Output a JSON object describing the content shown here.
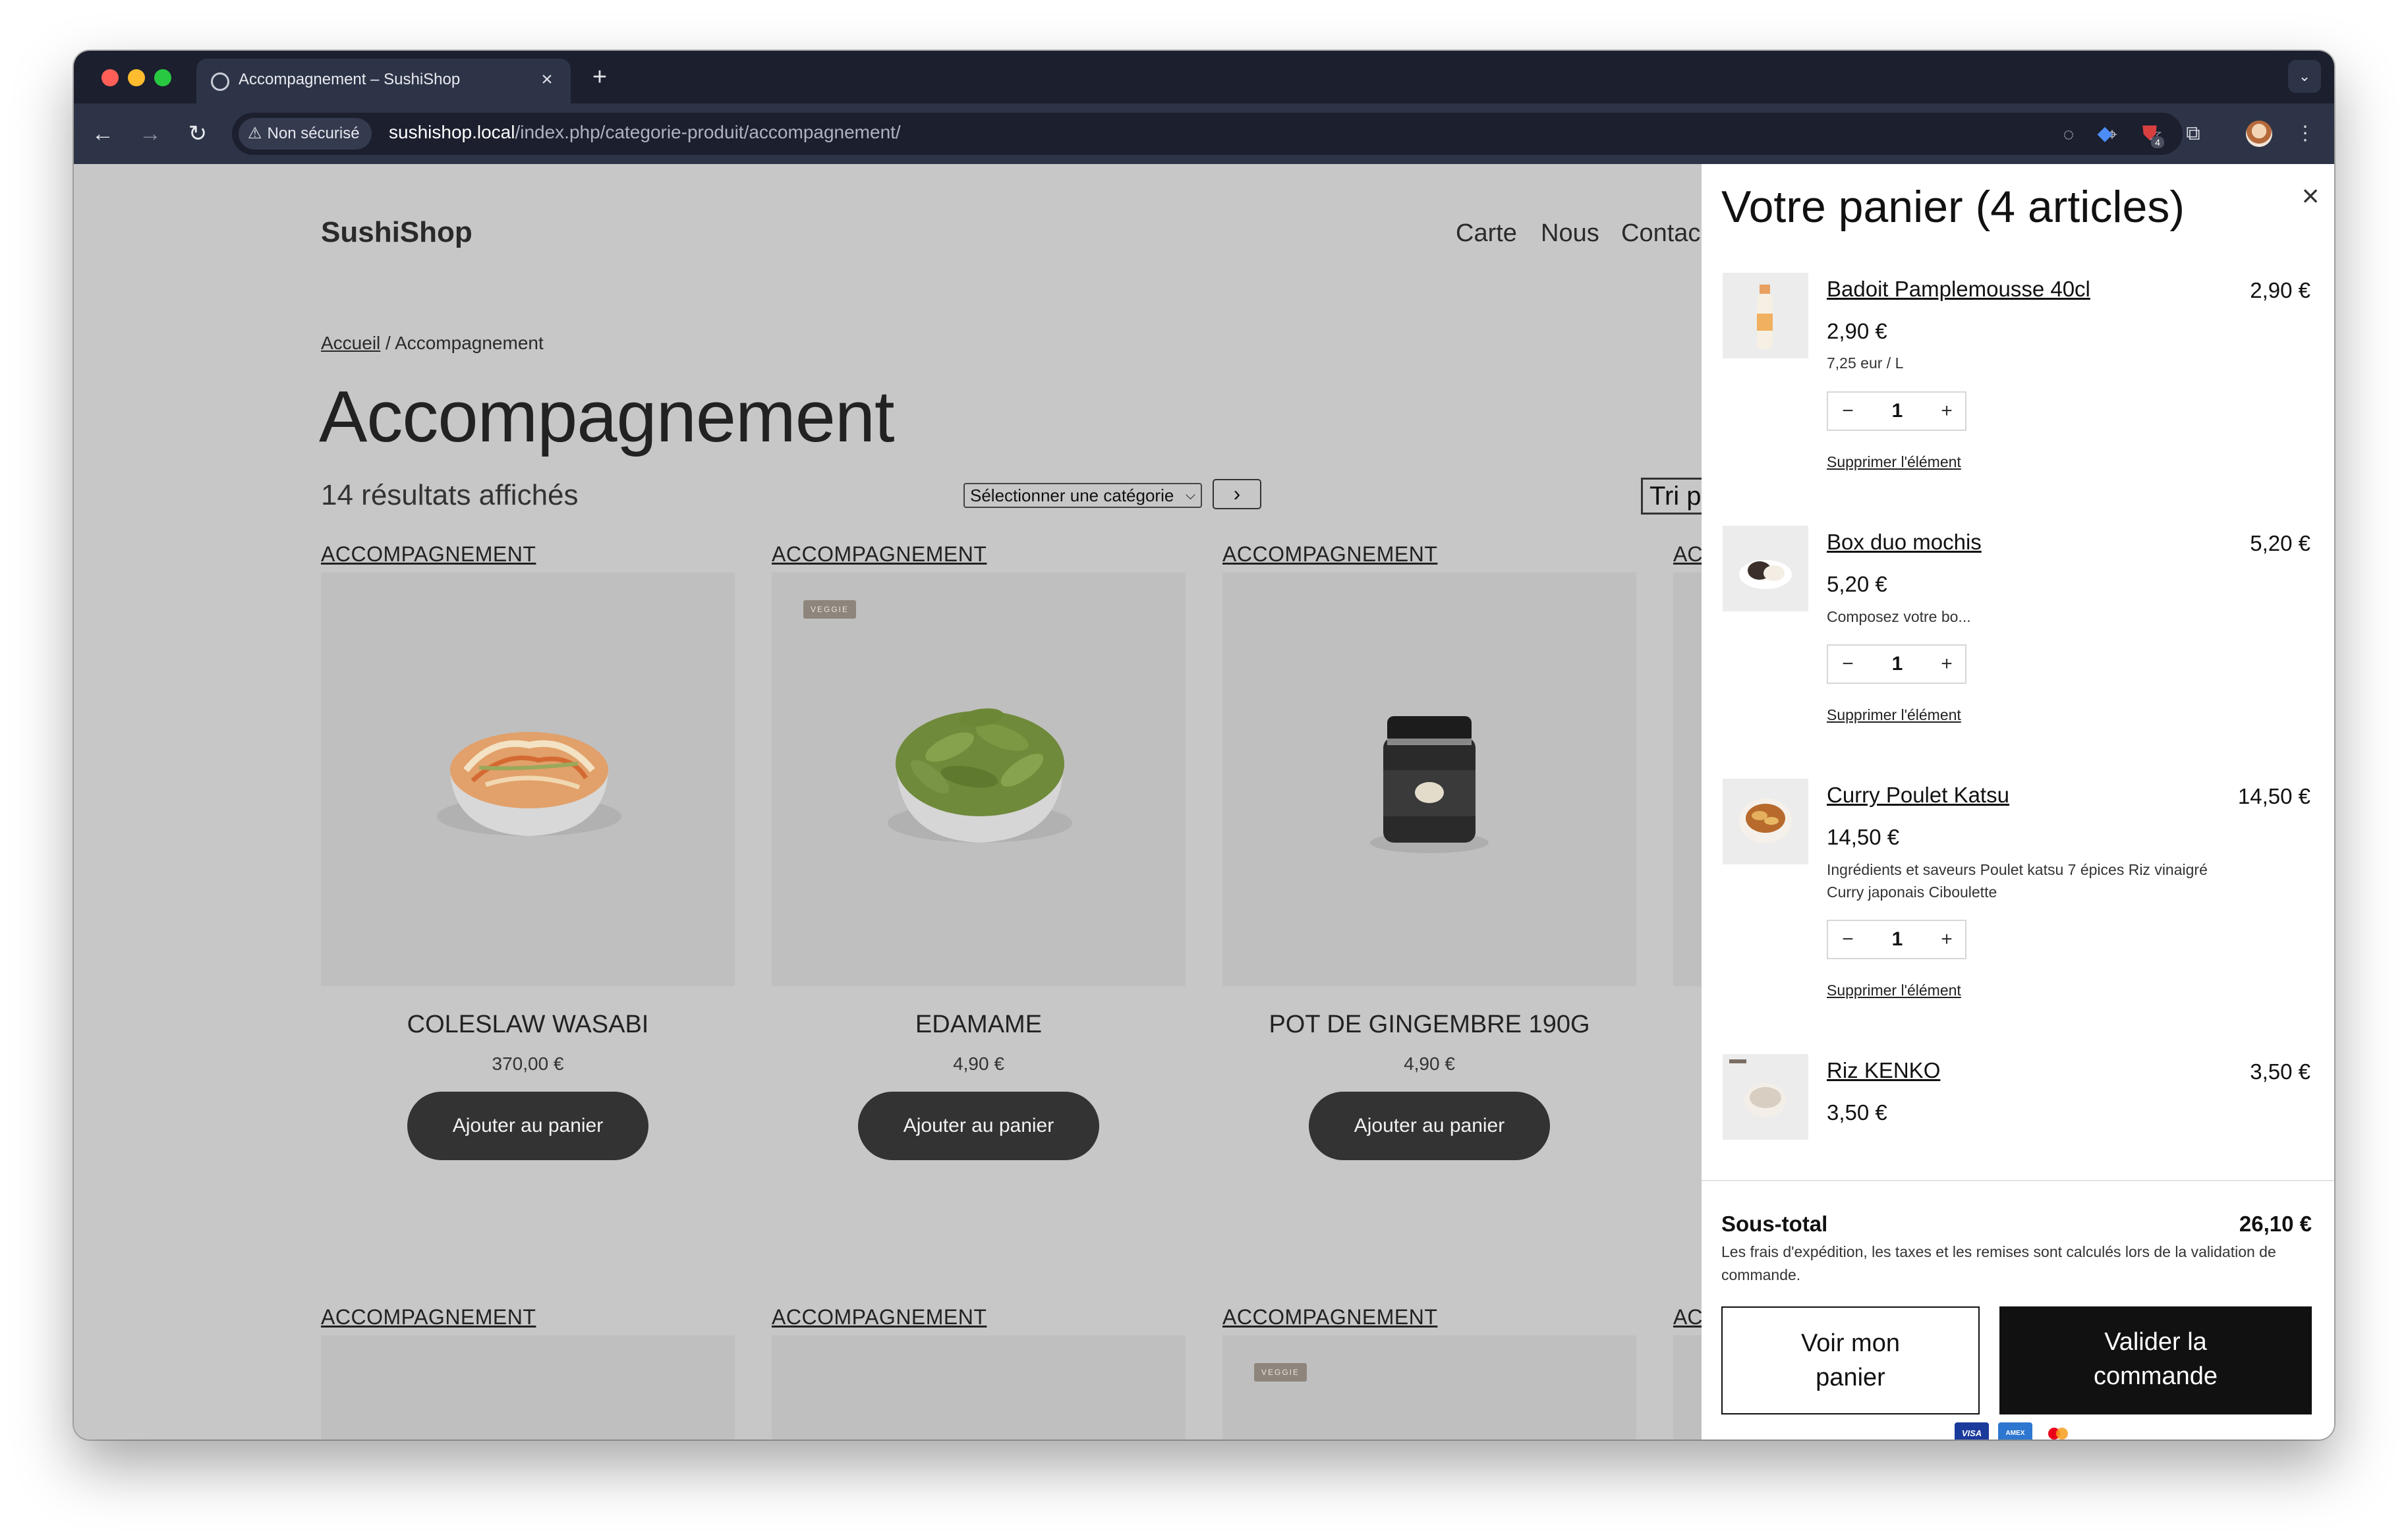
{
  "browser": {
    "tab_title": "Accompagnement – SushiShop",
    "security_label": "Non sécurisé",
    "url_host": "sushishop.local",
    "url_path": "/index.php/categorie-produit/accompagnement/",
    "extension_badge": "4"
  },
  "site": {
    "logo": "SushiShop",
    "menu": [
      "Carte",
      "Nous",
      "Contac"
    ]
  },
  "breadcrumb": {
    "home": "Accueil",
    "separator": " / ",
    "current": "Accompagnement"
  },
  "page_title": "Accompagnement",
  "results_count": "14 résultats affichés",
  "category_select": {
    "placeholder": "Sélectionner une catégorie",
    "go_icon": "chevron-right-icon"
  },
  "sort_label": "Tri p",
  "category_label": "ACCOMPAGNEMENT",
  "category_label_clipped": "AC",
  "veggie_badge": "VEGGIE",
  "products": [
    {
      "name": "COLESLAW WASABI",
      "price": "370,00 €",
      "button": "Ajouter au panier",
      "veggie": false
    },
    {
      "name": "EDAMAME",
      "price": "4,90 €",
      "button": "Ajouter au panier",
      "veggie": true
    },
    {
      "name": "POT DE GINGEMBRE 190G",
      "price": "4,90 €",
      "button": "Ajouter au panier",
      "veggie": false
    }
  ],
  "cart": {
    "title": "Votre panier (4 articles)",
    "remove_label": "Supprimer l'élément",
    "items": [
      {
        "name": "Badoit Pamplemousse 40cl",
        "line_total": "2,90 €",
        "price": "2,90 €",
        "desc": "7,25 eur / L",
        "qty": "1"
      },
      {
        "name": "Box duo mochis",
        "line_total": "5,20 €",
        "price": "5,20 €",
        "desc": "Composez votre bo...",
        "qty": "1"
      },
      {
        "name": "Curry Poulet Katsu",
        "line_total": "14,50 €",
        "price": "14,50 €",
        "desc": "Ingrédients et saveurs Poulet katsu 7 épices Riz vinaigré Curry japonais Ciboulette",
        "qty": "1"
      },
      {
        "name": "Riz KENKO",
        "line_total": "3,50 €",
        "price": "3,50 €"
      }
    ],
    "subtotal_label": "Sous-total",
    "subtotal_value": "26,10 €",
    "note": "Les frais d'expédition, les taxes et les remises sont calculés lors de la validation de commande.",
    "view_cart_button": "Voir mon panier",
    "checkout_button": "Valider la commande",
    "payment_icons": [
      "visa-icon",
      "amex-icon",
      "mastercard-icon"
    ],
    "payment_labels": {
      "visa": "VISA",
      "amex": "AMEX"
    }
  }
}
